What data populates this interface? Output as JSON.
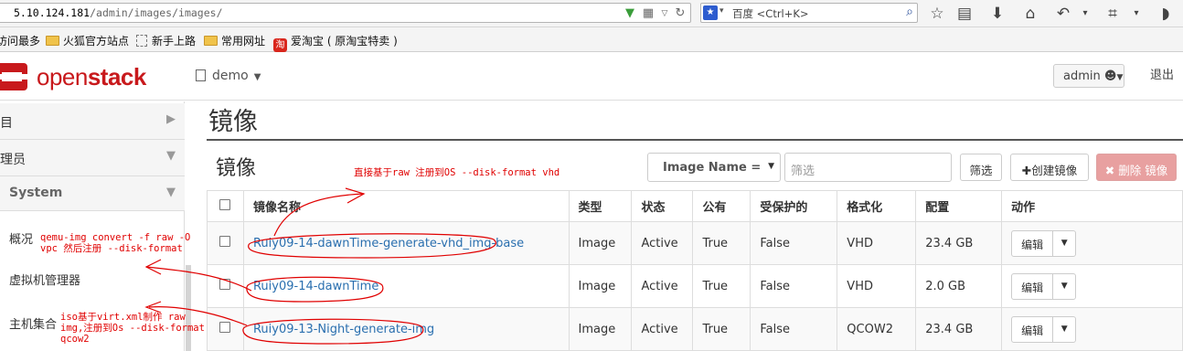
{
  "browser": {
    "url_host": "5.10.124.181",
    "url_path": "/admin/images/images/",
    "search_placeholder": "百度 <Ctrl+K>",
    "bookmarks": [
      "访问最多",
      "火狐官方站点",
      "新手上路",
      "常用网址",
      "爱淘宝 ( 原淘宝特卖 )"
    ],
    "taobao_glyph": "淘"
  },
  "header": {
    "logo_open": "open",
    "logo_stack": "stack",
    "project": "demo",
    "user": "admin",
    "logout": "退出"
  },
  "sidebar": {
    "section_project": "目",
    "section_admin": "理员",
    "subsection": "System",
    "items": [
      "概况",
      "虚拟机管理器",
      "主机集合"
    ]
  },
  "main": {
    "page_title": "镜像",
    "table_title": "镜像",
    "filter_field": "Image Name =",
    "filter_placeholder": "筛选",
    "filter_button": "筛选",
    "create_button": "创建镜像",
    "delete_button": "删除 镜像"
  },
  "table": {
    "headers": [
      "镜像名称",
      "类型",
      "状态",
      "公有",
      "受保护的",
      "格式化",
      "配置",
      "动作"
    ],
    "rows": [
      {
        "name": "Ruiy09-14-dawnTime-generate-vhd_img-base",
        "type": "Image",
        "status": "Active",
        "public": "True",
        "protected": "False",
        "format": "VHD",
        "size": "23.4 GB",
        "action": "编辑"
      },
      {
        "name": "Ruiy09-14-dawnTime",
        "type": "Image",
        "status": "Active",
        "public": "True",
        "protected": "False",
        "format": "VHD",
        "size": "2.0 GB",
        "action": "编辑"
      },
      {
        "name": "Ruiy09-13-Night-generate-img",
        "type": "Image",
        "status": "Active",
        "public": "True",
        "protected": "False",
        "format": "QCOW2",
        "size": "23.4 GB",
        "action": "编辑"
      }
    ]
  },
  "annotations": {
    "note_top": "直接基于raw 注册到OS --disk-format vhd",
    "note_qemu_1": "qemu-img convert -f raw -O",
    "note_qemu_2": "vpc 然后注册 --disk-format",
    "note_iso_1": "iso基于virt.xml制作 raw",
    "note_iso_2": "img,注册到Os --disk-format",
    "note_iso_3": "qcow2"
  },
  "colors": {
    "accent": "#c8191c",
    "link": "#2a6faf",
    "annotation": "#e00000",
    "delete_button": "#e8a0a0"
  }
}
